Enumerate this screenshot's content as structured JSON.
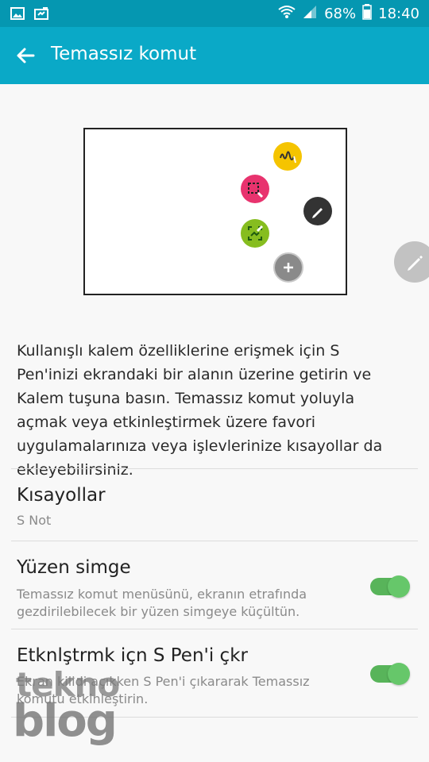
{
  "status_bar": {
    "battery_percent": "68%",
    "time": "18:40",
    "icons_left": [
      "gallery-icon",
      "screenshot-icon"
    ],
    "icons_right": [
      "wifi-icon",
      "signal-icon",
      "battery-icon"
    ]
  },
  "app_bar": {
    "title": "Temassız komut",
    "back_icon": "back-arrow-icon",
    "color": "#0aa9c7"
  },
  "preview": {
    "icons": [
      "pen-write-icon",
      "smart-select-icon",
      "pen-icon",
      "screen-write-icon",
      "add-icon"
    ],
    "colors": {
      "yellow": "#f5c400",
      "pink": "#e8336e",
      "dark": "#333333",
      "green": "#86bd1f",
      "grey": "#8a8a8a"
    }
  },
  "floating_icon": "floating-pen-icon",
  "description": "Kullanışlı kalem özelliklerine erişmek için S Pen'inizi ekrandaki bir alanın üzerine getirin ve Kalem tuşuna basın. Temassız komut yoluyla açmak veya etkinleştirmek üzere favori uygulamalarınıza veya işlevlerinize kısayollar da ekleyebilirsiniz.",
  "settings": [
    {
      "title": "Kısayollar",
      "subtitle": "S Not"
    },
    {
      "title": "Yüzen simge",
      "subtitle": "Temassız komut menüsünü, ekranın etrafında gezdirilebilecek bir yüzen simgeye küçültün.",
      "toggle": true
    },
    {
      "title": "Etknlştrmk içn S Pen'i çkr",
      "subtitle": "Ekran kilidi açıkken S Pen'i çıkararak Temassız komutu etkinleştirin.",
      "toggle": true
    }
  ],
  "watermark": {
    "line1": "tekno",
    "line2": "blog"
  },
  "accent_color": "#58b45a"
}
